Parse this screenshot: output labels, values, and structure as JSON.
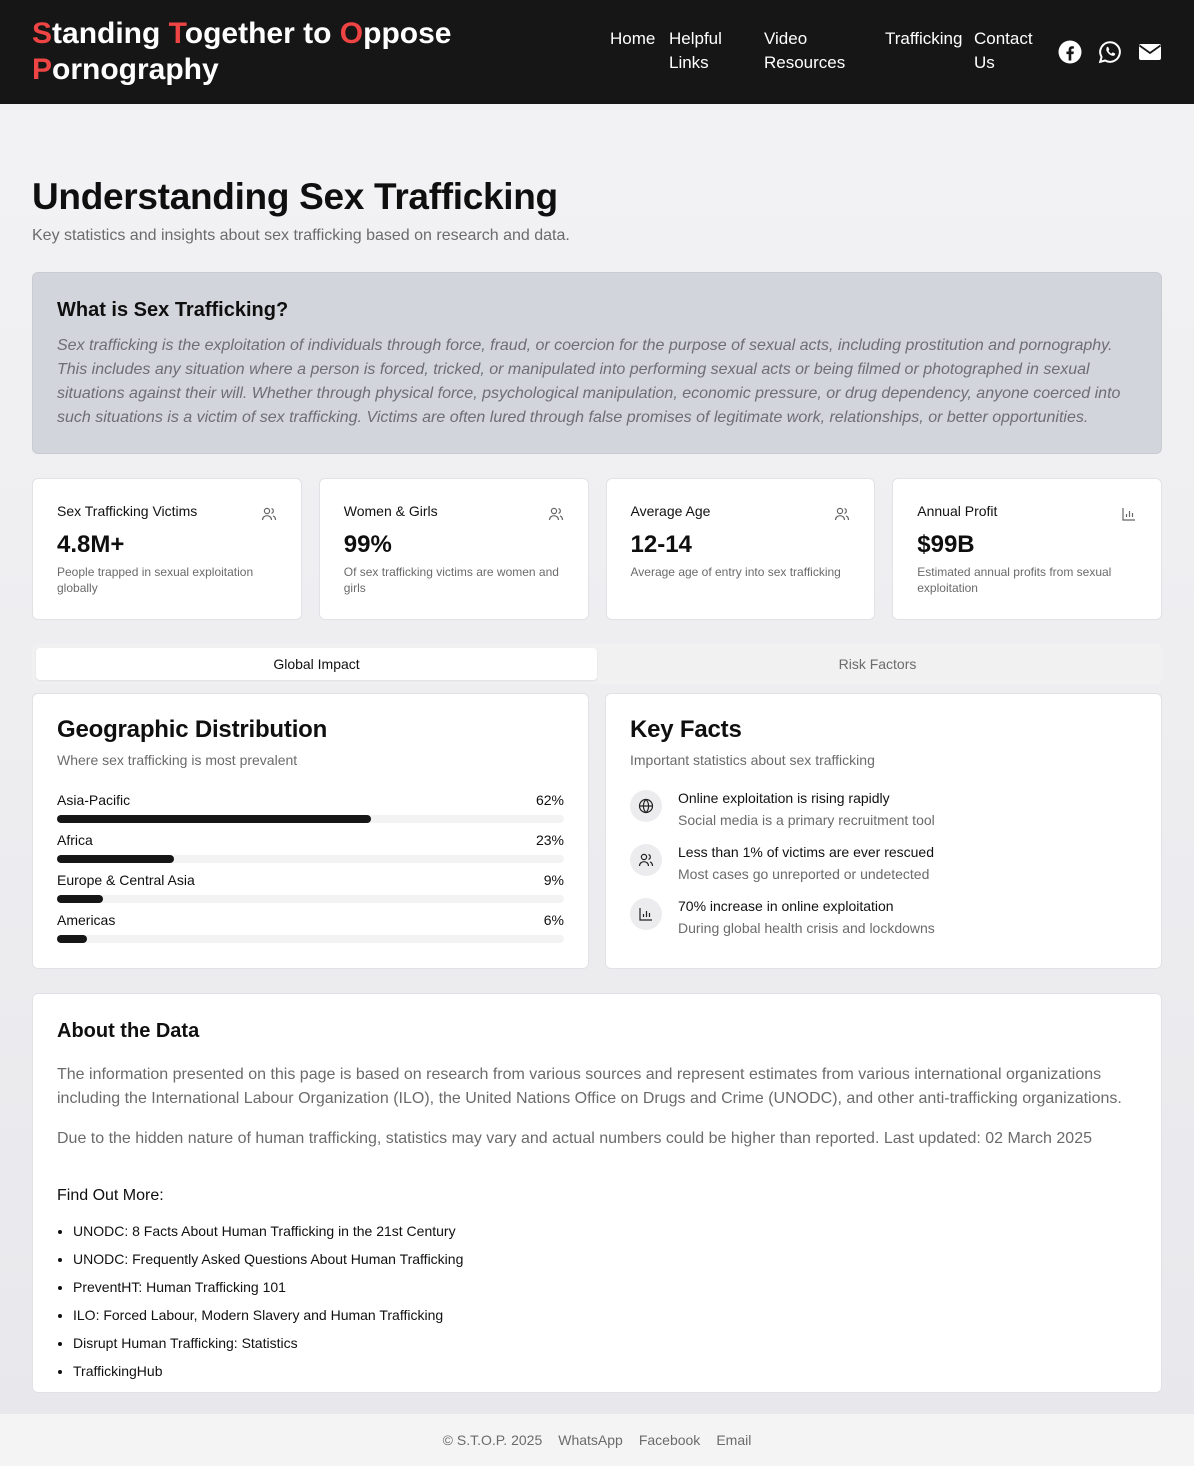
{
  "header": {
    "brand_parts": [
      {
        "red": "S",
        "rest": "tanding "
      },
      {
        "red": "T",
        "rest": "ogether to "
      },
      {
        "red": "O",
        "rest": "ppose"
      },
      {
        "red": "P",
        "rest": "ornography"
      }
    ],
    "nav": [
      "Home",
      "Helpful Links",
      "Video Resources",
      "Trafficking",
      "Contact Us"
    ],
    "social_icons": [
      "facebook-icon",
      "whatsapp-icon",
      "email-icon"
    ]
  },
  "page": {
    "title": "Understanding Sex Trafficking",
    "subtitle": "Key statistics and insights about sex trafficking based on research and data."
  },
  "definition": {
    "heading": "What is Sex Trafficking?",
    "text": "Sex trafficking is the exploitation of individuals through force, fraud, or coercion for the purpose of sexual acts, including prostitution and pornography. This includes any situation where a person is forced, tricked, or manipulated into performing sexual acts or being filmed or photographed in sexual situations against their will. Whether through physical force, psychological manipulation, economic pressure, or drug dependency, anyone coerced into such situations is a victim of sex trafficking. Victims are often lured through false promises of legitimate work, relationships, or better opportunities."
  },
  "stats": [
    {
      "label": "Sex Trafficking Victims",
      "value": "4.8M+",
      "desc": "People trapped in sexual exploitation globally",
      "icon": "users-icon"
    },
    {
      "label": "Women & Girls",
      "value": "99%",
      "desc": "Of sex trafficking victims are women and girls",
      "icon": "users-icon"
    },
    {
      "label": "Average Age",
      "value": "12-14",
      "desc": "Average age of entry into sex trafficking",
      "icon": "users-icon"
    },
    {
      "label": "Annual Profit",
      "value": "$99B",
      "desc": "Estimated annual profits from sexual exploitation",
      "icon": "bar-chart-icon"
    }
  ],
  "tabs": [
    {
      "label": "Global Impact",
      "active": true
    },
    {
      "label": "Risk Factors",
      "active": false
    }
  ],
  "geographic": {
    "title": "Geographic Distribution",
    "subtitle": "Where sex trafficking is most prevalent",
    "regions": [
      {
        "name": "Asia-Pacific",
        "percent_label": "62%",
        "percent": 62
      },
      {
        "name": "Africa",
        "percent_label": "23%",
        "percent": 23
      },
      {
        "name": "Europe & Central Asia",
        "percent_label": "9%",
        "percent": 9
      },
      {
        "name": "Americas",
        "percent_label": "6%",
        "percent": 6
      }
    ]
  },
  "key_facts": {
    "title": "Key Facts",
    "subtitle": "Important statistics about sex trafficking",
    "items": [
      {
        "title": "Online exploitation is rising rapidly",
        "desc": "Social media is a primary recruitment tool",
        "icon": "globe-icon"
      },
      {
        "title": "Less than 1% of victims are ever rescued",
        "desc": "Most cases go unreported or undetected",
        "icon": "users-icon"
      },
      {
        "title": "70% increase in online exploitation",
        "desc": "During global health crisis and lockdowns",
        "icon": "bar-chart-icon"
      }
    ]
  },
  "about": {
    "heading": "About the Data",
    "p1": "The information presented on this page is based on research from various sources and represent estimates from various international organizations including the International Labour Organization (ILO), the United Nations Office on Drugs and Crime (UNODC), and other anti-trafficking organizations.",
    "p2": "Due to the hidden nature of human trafficking, statistics may vary and actual numbers could be higher than reported. Last updated: 02 March 2025",
    "find_more": "Find Out More:",
    "links": [
      "UNODC: 8 Facts About Human Trafficking in the 21st Century",
      "UNODC: Frequently Asked Questions About Human Trafficking",
      "PreventHT: Human Trafficking 101",
      "ILO: Forced Labour, Modern Slavery and Human Trafficking",
      "Disrupt Human Trafficking: Statistics",
      "TraffickingHub"
    ]
  },
  "footer": {
    "copyright": "© S.T.O.P. 2025",
    "links": [
      "WhatsApp",
      "Facebook",
      "Email"
    ]
  },
  "colors": {
    "accent_red": "#ef4444",
    "header_bg": "#161616",
    "bar_fill": "#161616"
  }
}
